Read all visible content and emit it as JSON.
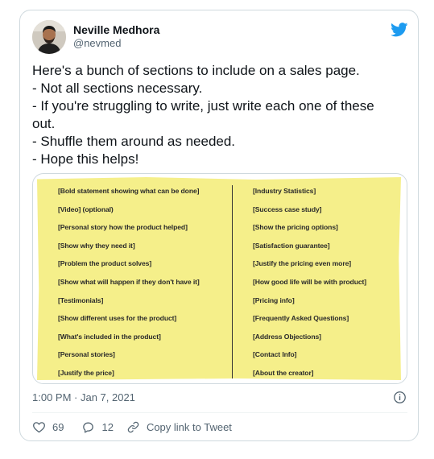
{
  "author": {
    "name": "Neville Medhora",
    "handle": "@nevmed"
  },
  "tweet": {
    "lines": [
      "Here's a bunch of sections to include on a sales page.",
      "- Not all sections necessary.",
      "- If you're struggling to write, just write each one of these",
      "out.",
      "- Shuffle them around as needed.",
      "- Hope this helps!"
    ]
  },
  "image": {
    "left_column": [
      "[Bold statement showing what can be done]",
      "[Video] (optional)",
      "[Personal story how the product helped]",
      "[Show why they need it]",
      "[Problem the product solves]",
      "[Show what will happen if they don't have it]",
      "[Testimonials]",
      "[Show different uses for the product]",
      "[What's included in the product]",
      "[Personal stories]",
      "[Justify the price]"
    ],
    "right_column": [
      "[Industry Statistics]",
      "[Success case study]",
      "[Show the pricing options]",
      "[Satisfaction guarantee]",
      "[Justify the pricing even more]",
      "[How good life will be with product]",
      "[Pricing info]",
      "[Frequently Asked Questions]",
      "[Address Objections]",
      "[Contact Info]",
      "[About the creator]"
    ],
    "note_color": "#f5ef8a"
  },
  "meta": {
    "timestamp": "1:00 PM · Jan 7, 2021"
  },
  "actions": {
    "likes": "69",
    "replies": "12",
    "copy_link": "Copy link to Tweet"
  },
  "colors": {
    "twitter_blue": "#1d9bf0",
    "muted_text": "#536471",
    "border": "#cfd9de"
  },
  "icons": [
    "twitter-bird-icon",
    "info-icon",
    "heart-icon",
    "reply-bubble-icon",
    "link-icon"
  ]
}
